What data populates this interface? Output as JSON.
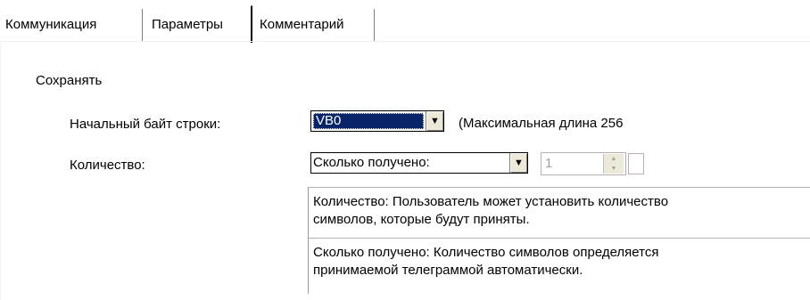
{
  "tabs": [
    {
      "label": "Коммуникация"
    },
    {
      "label": "Параметры"
    },
    {
      "label": "Комментарий"
    }
  ],
  "section": {
    "title": "Сохранять"
  },
  "start_byte": {
    "label": "Начальный байт строки:",
    "value": "VB0",
    "hint": "(Максимальная длина 256"
  },
  "quantity": {
    "label": "Количество:",
    "value": "Сколько получено:",
    "spin_value": "1"
  },
  "descriptions": [
    {
      "text_line1": "Количество: Пользователь может установить количество",
      "text_line2": "символов, которые будут приняты."
    },
    {
      "text_line1": "Сколько получено: Количество символов определяется",
      "text_line2": "принимаемой телеграммой автоматически."
    }
  ],
  "icons": {
    "dropdown": "dropdown-arrow-icon",
    "spinner": "spinner-arrows-icon"
  }
}
